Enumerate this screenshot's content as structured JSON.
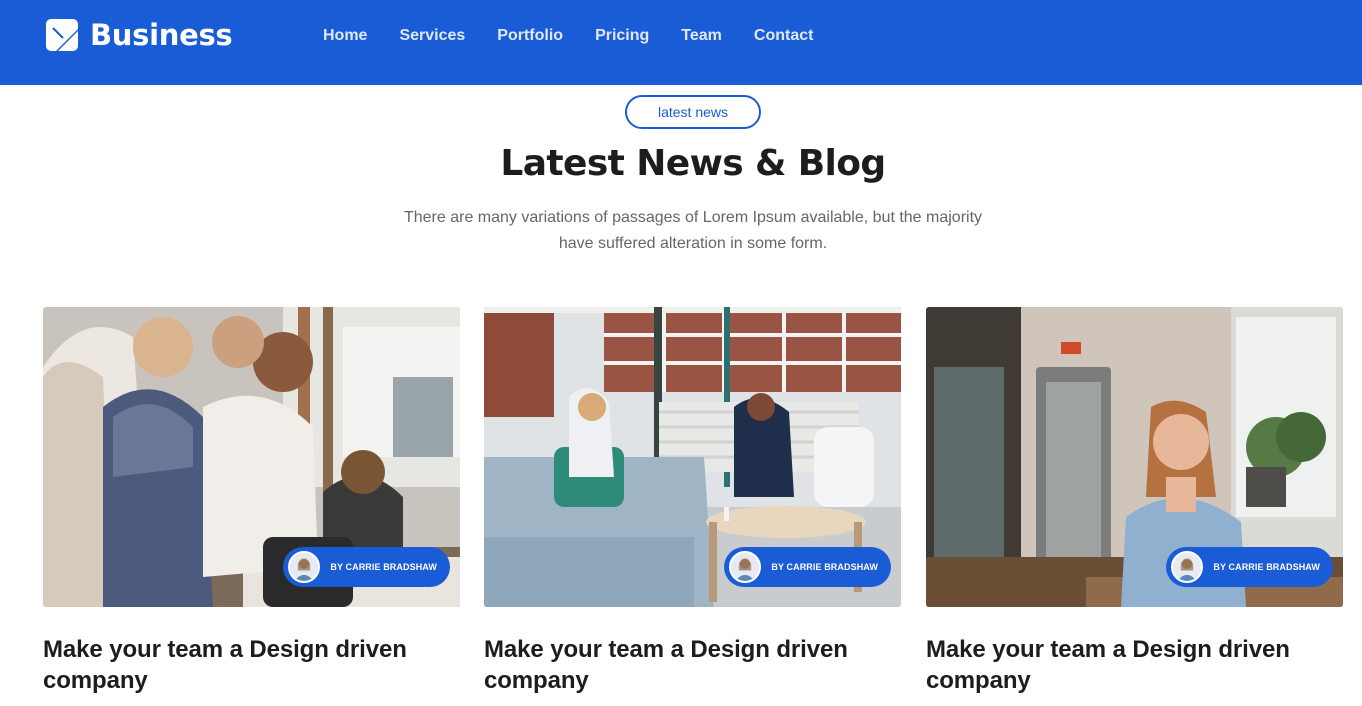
{
  "header": {
    "brand_name": "Business",
    "logo_icon": "brand-logo-icon",
    "background_color": "#1a5cd6",
    "nav": [
      {
        "label": "Home"
      },
      {
        "label": "Services"
      },
      {
        "label": "Portfolio"
      },
      {
        "label": "Pricing"
      },
      {
        "label": "Team"
      },
      {
        "label": "Contact"
      }
    ]
  },
  "section": {
    "tag": "latest news",
    "title": "Latest News & Blog",
    "description": "There are many variations of passages of Lorem Ipsum available, but the majority have suffered alteration in some form."
  },
  "posts": [
    {
      "image": "team-meeting-photo",
      "author": "BY CARRIE BRADSHAW",
      "title": "Make your team a Design driven company"
    },
    {
      "image": "office-lounge-photo",
      "author": "BY CARRIE BRADSHAW",
      "title": "Make your team a Design driven company"
    },
    {
      "image": "cafe-woman-photo",
      "author": "BY CARRIE BRADSHAW",
      "title": "Make your team a Design driven company"
    }
  ],
  "colors": {
    "accent": "#1a5cd6",
    "heading": "#1d1d1d",
    "muted": "#666666"
  }
}
